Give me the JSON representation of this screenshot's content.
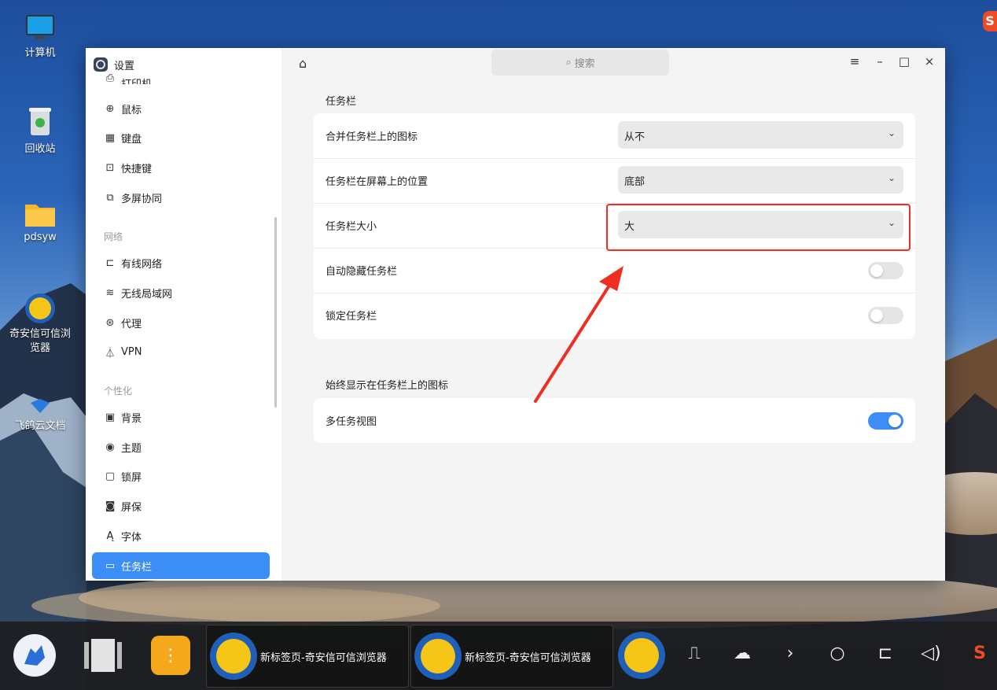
{
  "desktop": {
    "icons": [
      {
        "label": "计算机",
        "icon": "computer-icon"
      },
      {
        "label": "回收站",
        "icon": "trash-icon"
      },
      {
        "label": "pdsyw",
        "icon": "folder-icon"
      },
      {
        "label": "奇安信可信浏览器",
        "icon": "browser-icon"
      },
      {
        "label": "飞鸽云文档",
        "icon": "cloud-doc-icon"
      }
    ],
    "sogou_label": "S"
  },
  "window": {
    "app_title": "设置",
    "search_placeholder": "搜索",
    "sidebar": {
      "partial_item": {
        "label": "打印机",
        "icon": "printer-icon"
      },
      "items_device": [
        {
          "label": "鼠标",
          "icon": "mouse-icon"
        },
        {
          "label": "键盘",
          "icon": "keyboard-icon"
        },
        {
          "label": "快捷键",
          "icon": "shortcut-icon"
        },
        {
          "label": "多屏协同",
          "icon": "multiscreen-icon"
        }
      ],
      "group_network": "网络",
      "items_network": [
        {
          "label": "有线网络",
          "icon": "wired-network-icon"
        },
        {
          "label": "无线局域网",
          "icon": "wifi-icon"
        },
        {
          "label": "代理",
          "icon": "proxy-icon"
        },
        {
          "label": "VPN",
          "icon": "vpn-icon"
        }
      ],
      "group_personal": "个性化",
      "items_personal": [
        {
          "label": "背景",
          "icon": "background-icon"
        },
        {
          "label": "主题",
          "icon": "theme-icon"
        },
        {
          "label": "锁屏",
          "icon": "lockscreen-icon"
        },
        {
          "label": "屏保",
          "icon": "screensaver-icon"
        },
        {
          "label": "字体",
          "icon": "font-icon"
        },
        {
          "label": "任务栏",
          "icon": "taskbar-icon",
          "active": true
        }
      ]
    },
    "main": {
      "section1_title": "任务栏",
      "rows": [
        {
          "label": "合并任务栏上的图标",
          "type": "select",
          "value": "从不"
        },
        {
          "label": "任务栏在屏幕上的位置",
          "type": "select",
          "value": "底部"
        },
        {
          "label": "任务栏大小",
          "type": "select",
          "value": "大"
        },
        {
          "label": "自动隐藏任务栏",
          "type": "toggle",
          "on": false
        },
        {
          "label": "锁定任务栏",
          "type": "toggle",
          "on": false
        }
      ],
      "section2_title": "始终显示在任务栏上的图标",
      "rows2": [
        {
          "label": "多任务视图",
          "type": "toggle",
          "on": true
        }
      ]
    }
  },
  "taskbar": {
    "windows": [
      {
        "label": "新标签页-奇安信可信浏览器"
      },
      {
        "label": "新标签页-奇安信可信浏览器"
      }
    ],
    "tray_icons": [
      "usb-icon",
      "cloud-icon",
      "chevron-right-icon",
      "search-icon",
      "network-icon",
      "volume-icon",
      "sogou-icon"
    ]
  },
  "colors": {
    "accent": "#3c8df6",
    "annotation_red": "#ee2d23"
  }
}
